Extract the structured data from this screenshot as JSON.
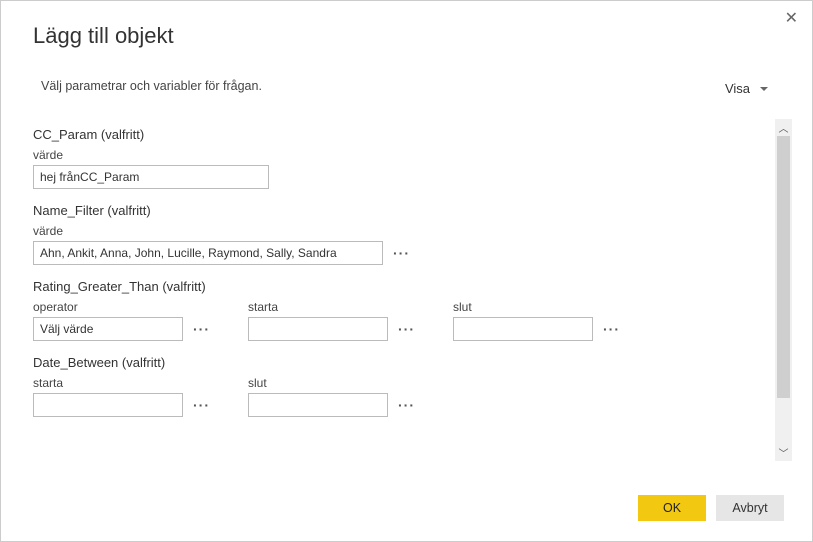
{
  "dialog": {
    "title": "Lägg till objekt",
    "subtitle": "Välj parametrar och variabler för frågan.",
    "visa_label": "Visa"
  },
  "sections": {
    "cc_param": {
      "title": "CC_Param (valfritt)",
      "value_label": "värde",
      "value": "hej frånCC_Param"
    },
    "name_filter": {
      "title": "Name_Filter (valfritt)",
      "value_label": "värde",
      "value": "Ahn, Ankit, Anna, John, Lucille, Raymond, Sally, Sandra"
    },
    "rating_gt": {
      "title": "Rating_Greater_Than (valfritt)",
      "operator_label": "operator",
      "operator_value": "Välj värde",
      "start_label": "starta",
      "start_value": "",
      "end_label": "slut",
      "end_value": ""
    },
    "date_between": {
      "title": "Date_Between (valfritt)",
      "start_label": "starta",
      "start_value": "",
      "end_label": "slut",
      "end_value": ""
    }
  },
  "footer": {
    "ok": "OK",
    "cancel": "Avbryt"
  }
}
